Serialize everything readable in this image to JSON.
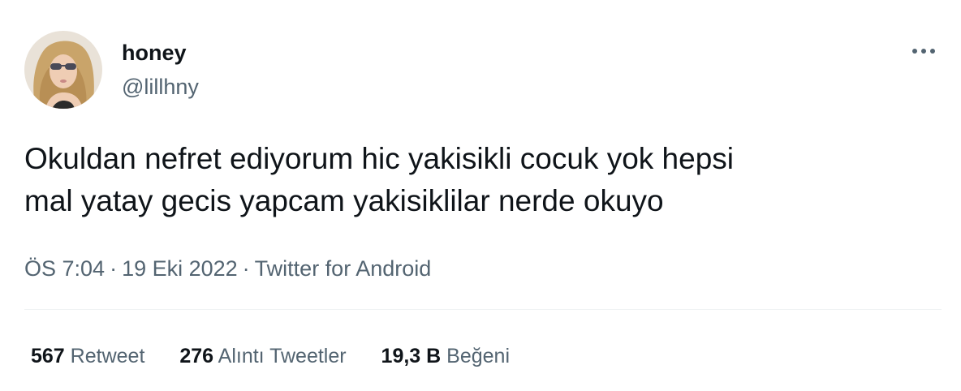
{
  "user": {
    "display_name": "honey",
    "handle": "@lillhny",
    "avatar_icon": "profile-photo"
  },
  "more_icon": "more-dots-icon",
  "tweet": {
    "lines": [
      "Okuldan nefret ediyorum hic yakisikli cocuk yok hepsi",
      "mal yatay gecis yapcam yakisiklilar nerde okuyo"
    ]
  },
  "meta": {
    "time": "ÖS 7:04",
    "separator": "·",
    "date": "19 Eki 2022",
    "source": "Twitter for Android"
  },
  "stats": [
    {
      "count": "567",
      "label": "Retweet"
    },
    {
      "count": "276",
      "label": "Alıntı Tweetler"
    },
    {
      "count": "19,3 B",
      "label": "Beğeni"
    }
  ],
  "colors": {
    "text_primary": "#0f1419",
    "text_secondary": "#536471",
    "divider": "#eff3f4"
  }
}
